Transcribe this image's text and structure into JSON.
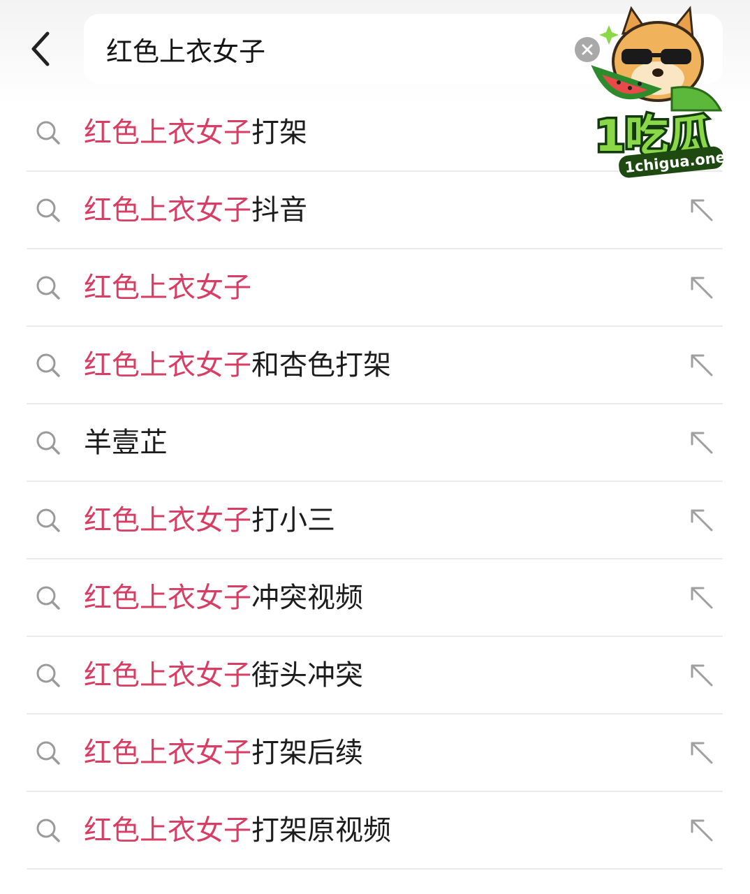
{
  "header": {
    "search_value": "红色上衣女子",
    "back_icon": "chevron-left-icon",
    "clear_icon": "clear-circle-icon"
  },
  "colors": {
    "highlight": "#d83d63",
    "text": "#1c1c1c",
    "icon_gray": "#9a9a9a",
    "divider": "#ebebeb"
  },
  "suggestions": [
    {
      "match": "红色上衣女子",
      "rest": "打架"
    },
    {
      "match": "红色上衣女子",
      "rest": "抖音"
    },
    {
      "match": "红色上衣女子",
      "rest": ""
    },
    {
      "match": "红色上衣女子",
      "rest": "和杏色打架"
    },
    {
      "match": "",
      "rest": "羊壹芷"
    },
    {
      "match": "红色上衣女子",
      "rest": "打小三"
    },
    {
      "match": "红色上衣女子",
      "rest": "冲突视频"
    },
    {
      "match": "红色上衣女子",
      "rest": "街头冲突"
    },
    {
      "match": "红色上衣女子",
      "rest": "打架后续"
    },
    {
      "match": "红色上衣女子",
      "rest": "打架原视频"
    }
  ],
  "watermark": {
    "logo_text": "1吃瓜",
    "site": "1chigua.one"
  }
}
